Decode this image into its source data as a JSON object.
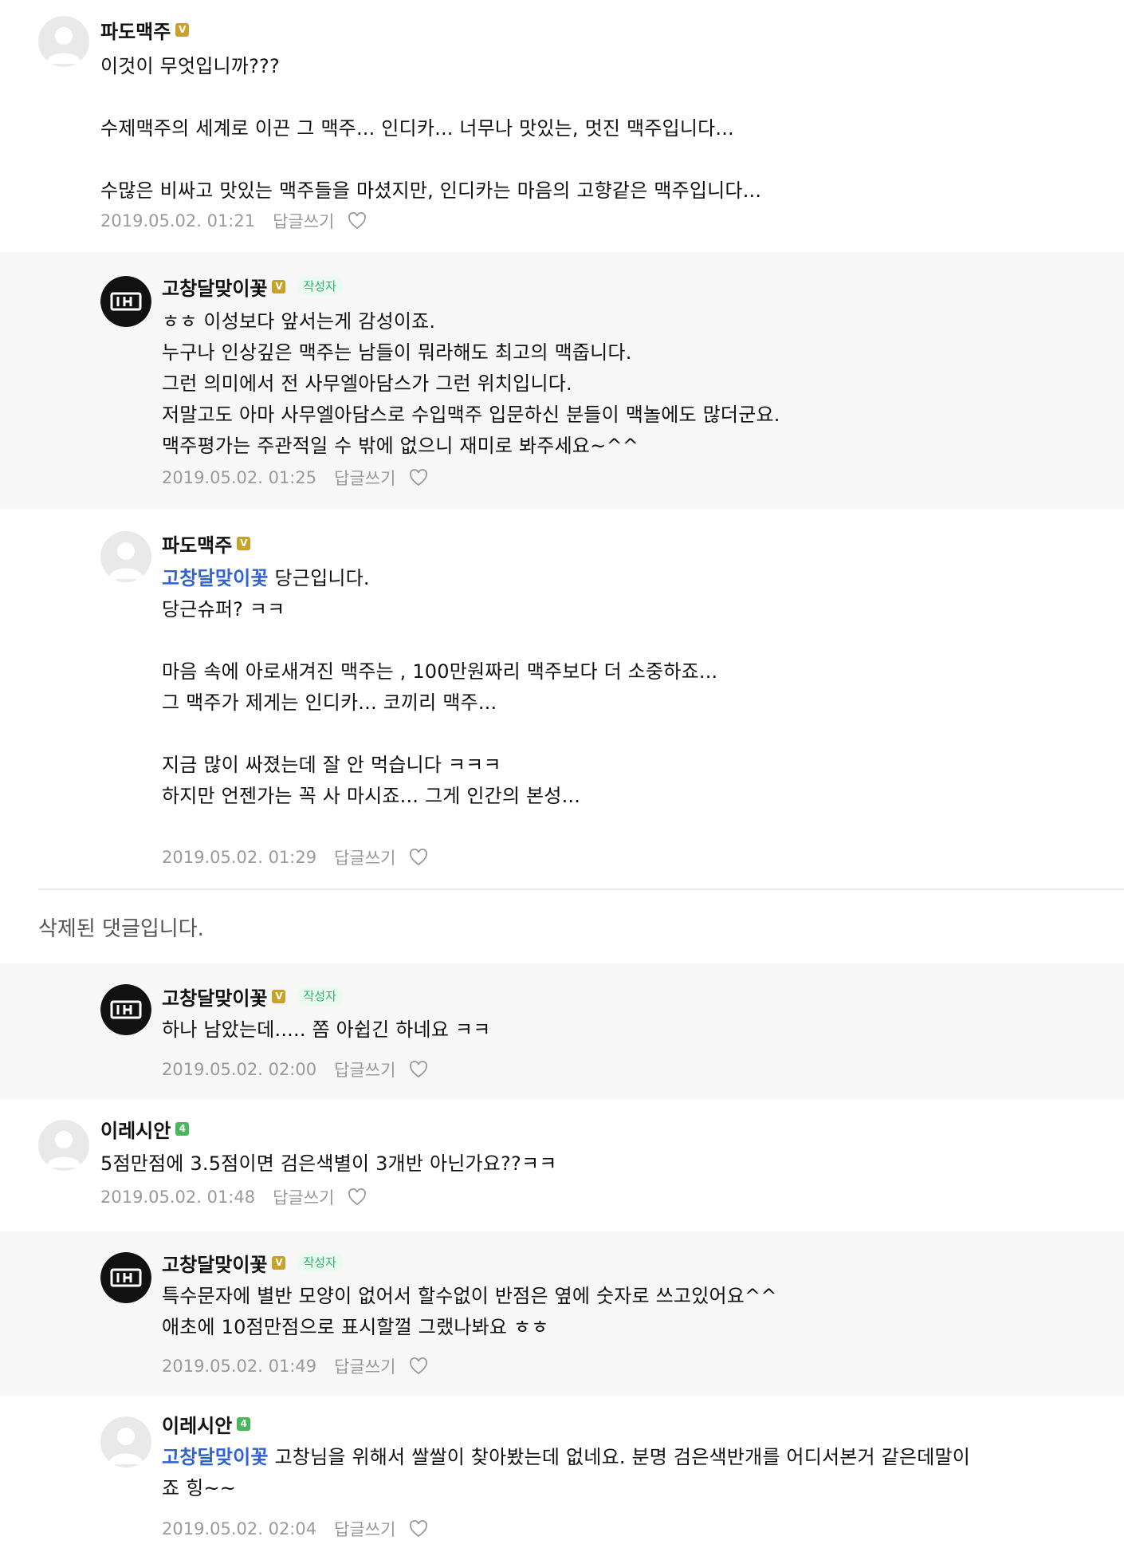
{
  "comments": {
    "c1": {
      "nick": "파도맥주",
      "level": "V",
      "text": "이것이 무엇입니까???\n\n수제맥주의 세계로 이끈 그 맥주... 인디카... 너무나 맛있는, 멋진 맥주입니다...\n\n수많은 비싸고 맛있는 맥주들을 마셨지만, 인디카는 마음의 고향같은 맥주입니다...",
      "date": "2019.05.02. 01:21",
      "reply_label": "답글쓰기"
    },
    "c2": {
      "nick": "고창달맞이꽃",
      "level": "V",
      "badge": "작성자",
      "text": "ㅎㅎ 이성보다 앞서는게 감성이죠.\n누구나 인상깊은 맥주는 남들이 뭐라해도 최고의 맥줍니다.\n그런 의미에서 전 사무엘아담스가 그런 위치입니다.\n저말고도 아마 사무엘아담스로 수입맥주 입문하신 분들이 맥놀에도 많더군요.\n맥주평가는 주관적일 수 밖에 없으니 재미로 봐주세요~^^",
      "date": "2019.05.02. 01:25",
      "reply_label": "답글쓰기"
    },
    "c3": {
      "nick": "파도맥주",
      "level": "V",
      "mention": "고창달맞이꽃",
      "text": " 당근입니다.\n당근슈퍼? ㅋㅋ\n\n마음 속에 아로새겨진 맥주는 , 100만원짜리 맥주보다 더 소중하죠...\n그 맥주가 제게는 인디카... 코끼리 맥주...\n\n지금 많이 싸졌는데 잘 안 먹습니다 ㅋㅋㅋ\n하지만 언젠가는 꼭 사 마시죠... 그게 인간의 본성...",
      "date": "2019.05.02. 01:29",
      "reply_label": "답글쓰기"
    },
    "deleted": {
      "text": "삭제된 댓글입니다."
    },
    "c4": {
      "nick": "고창달맞이꽃",
      "level": "V",
      "badge": "작성자",
      "text": "하나 남았는데..... 쫌 아쉽긴 하네요 ㅋㅋ",
      "date": "2019.05.02. 02:00",
      "reply_label": "답글쓰기"
    },
    "c5": {
      "nick": "이레시안",
      "level": "4",
      "text": "5점만점에 3.5점이면 검은색별이 3개반 아닌가요??ㅋㅋ",
      "date": "2019.05.02. 01:48",
      "reply_label": "답글쓰기"
    },
    "c6": {
      "nick": "고창달맞이꽃",
      "level": "V",
      "badge": "작성자",
      "text": "특수문자에 별반 모양이 없어서 할수없이 반점은 옆에 숫자로 쓰고있어요^^\n애초에 10점만점으로 표시할껄 그랬나봐요 ㅎㅎ",
      "date": "2019.05.02. 01:49",
      "reply_label": "답글쓰기"
    },
    "c7": {
      "nick": "이레시안",
      "level": "4",
      "mention": "고창달맞이꽃",
      "text": " 고창님을 위해서 쌀쌀이 찾아봤는데 없네요. 분명 검은색반개를 어디서본거 같은데말이\n죠 힝~~",
      "date": "2019.05.02. 02:04",
      "reply_label": "답글쓰기"
    }
  },
  "icons": {
    "avatar_default": "person-silhouette-icon",
    "avatar_brand": "brand-logo-icon",
    "like": "heart-icon"
  },
  "colors": {
    "mention": "#2f61d4",
    "level_gold": "#c9a227",
    "level_green": "#49b75c",
    "author_badge": "#2db36b",
    "reply_bg": "#f7f7f7"
  }
}
